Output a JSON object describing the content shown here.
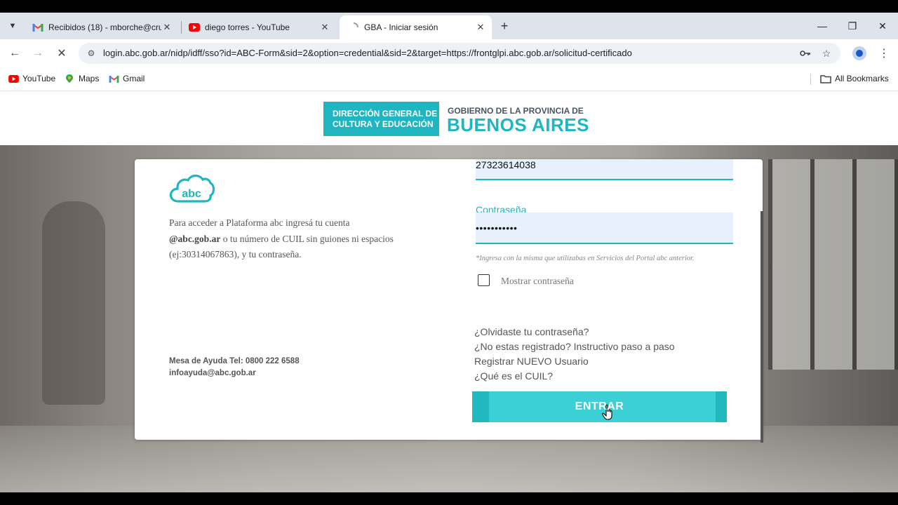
{
  "tabs": [
    {
      "title": "Recibidos (18) - mborche@cru",
      "icon": "gmail-icon"
    },
    {
      "title": "diego torres - YouTube",
      "icon": "youtube-icon"
    },
    {
      "title": "GBA - Iniciar sesión",
      "icon": "loading-icon"
    }
  ],
  "toolbar": {
    "url": "login.abc.gob.ar/nidp/idff/sso?id=ABC-Form&sid=2&option=credential&sid=2&target=https://frontglpi.abc.gob.ar/solicitud-certificado"
  },
  "bookmarks": {
    "items": [
      "YouTube",
      "Maps",
      "Gmail"
    ],
    "all": "All Bookmarks"
  },
  "banner": {
    "dgce_line1": "DIRECCIÓN GENERAL DE",
    "dgce_line2": "CULTURA Y EDUCACIÓN",
    "gov_line": "GOBIERNO DE LA PROVINCIA DE",
    "province": "BUENOS AIRES"
  },
  "login": {
    "logo_text": "abc",
    "intro_1": "Para acceder a Plataforma abc ingresá tu cuenta",
    "intro_domain": "@abc.gob.ar",
    "intro_2": " o tu número de CUIL sin guiones ni espacios (ej:30314067863), y tu contraseña.",
    "help_phone": "Mesa de Ayuda Tel: 0800 222 6588",
    "help_email": "infoayuda@abc.gob.ar",
    "username_value": "27323614038",
    "password_label": "Contraseña",
    "password_value": "•••••••••••",
    "password_hint": "*Ingresa con la misma que utilizabas en Servicios del Portal abc anterior.",
    "show_password_label": "Mostrar contraseña",
    "links": [
      "¿Olvidaste tu contraseña?",
      "¿No estas registrado? Instructivo paso a paso",
      "Registrar NUEVO Usuario",
      "¿Qué es el CUIL?"
    ],
    "submit_label": "ENTRAR"
  },
  "colors": {
    "accent": "#1fb6c1",
    "button": "#3ccfd6",
    "field_bg": "#e8f0fe"
  }
}
